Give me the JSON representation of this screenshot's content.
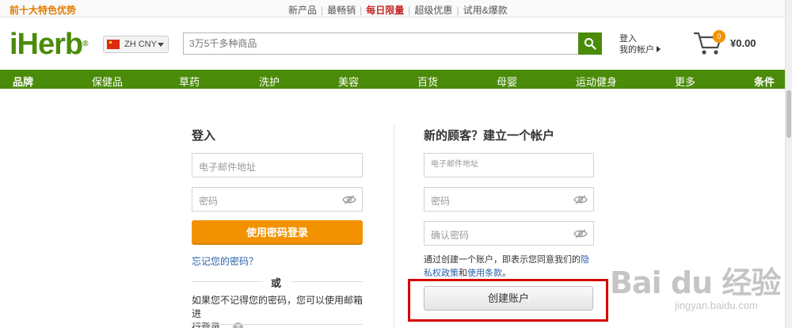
{
  "promo": {
    "left": "前十大特色优势",
    "links": [
      "新产品",
      "最畅销",
      "每日限量",
      "超级优惠",
      "试用&爆款"
    ],
    "hot_index": 2
  },
  "header": {
    "logo": "iHerb",
    "logo_mark": "®",
    "locale": "ZH  CNY",
    "search_placeholder": "3万5千多种商品",
    "login": "登入",
    "my_account": "我的帐户",
    "cart_count": "0",
    "cart_total": "¥0.00"
  },
  "nav": [
    "品牌",
    "保健品",
    "草药",
    "洗护",
    "美容",
    "百货",
    "母婴",
    "运动健身",
    "更多",
    "条件"
  ],
  "login": {
    "title": "登入",
    "email_placeholder": "电子邮件地址",
    "password_placeholder": "密码",
    "submit": "使用密码登录",
    "forgot": "忘记您的密码？",
    "or": "或",
    "note": "如果您不记得您的密码，您可以使用邮箱进行登录。",
    "note_line1": "如果您不记得您的密码，您可以使用邮箱进",
    "note_line2": "行登录。",
    "help": "?"
  },
  "register": {
    "title": "新的顾客？建立一个帐户",
    "email_placeholder": "电子邮件地址",
    "password_placeholder": "密码",
    "confirm_placeholder": "确认密码",
    "terms_prefix": "通过创建一个账户，即表示您同意我们的",
    "terms_link1": "隐",
    "terms_link2": "私权政策",
    "terms_and": "和",
    "terms_link3": "使用条款",
    "terms_end": "。",
    "submit": "创建账户"
  },
  "watermark": {
    "main": "Bai du 经验",
    "sub": "jingyan.baidu.com"
  },
  "colors": {
    "brand_green": "#4b8b0a",
    "orange": "#f39200",
    "highlight_red": "#d60000",
    "link_blue": "#2a61a8"
  }
}
